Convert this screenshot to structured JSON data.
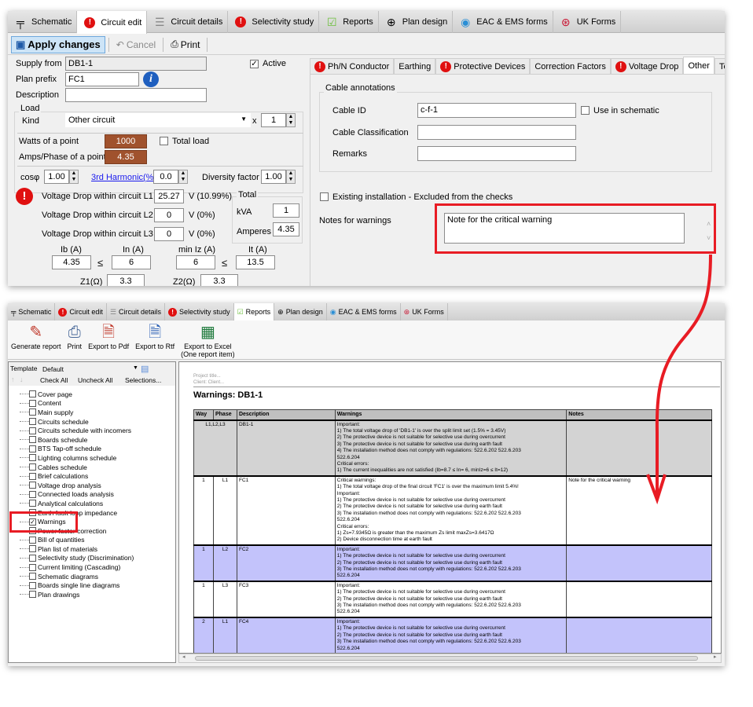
{
  "top_window": {
    "tabs": [
      {
        "label": "Schematic",
        "icon": "schematic-icon"
      },
      {
        "label": "Circuit edit",
        "icon": "circuit-edit-icon",
        "active": true
      },
      {
        "label": "Circuit details",
        "icon": "circuit-details-icon"
      },
      {
        "label": "Selectivity study",
        "icon": "selectivity-icon"
      },
      {
        "label": "Reports",
        "icon": "reports-icon"
      },
      {
        "label": "Plan design",
        "icon": "plan-design-icon"
      },
      {
        "label": "EAC & EMS forms",
        "icon": "eac-icon"
      },
      {
        "label": "UK Forms",
        "icon": "uk-flag-icon"
      }
    ],
    "toolbar": {
      "apply": "Apply changes",
      "cancel": "Cancel",
      "print": "Print"
    },
    "form": {
      "supply_from_label": "Supply from",
      "supply_from": "DB1-1",
      "active_label": "Active",
      "active_checked": true,
      "plan_prefix_label": "Plan prefix",
      "plan_prefix": "FC1",
      "description_label": "Description",
      "description": "",
      "load_label": "Load",
      "kind_label": "Kind",
      "kind": "Other circuit",
      "x_label": "x",
      "multiplier": "1",
      "watts_label": "Watts of a point",
      "watts": "1000",
      "total_load_label": "Total load",
      "total_load_checked": false,
      "amps_label": "Amps/Phase of a point",
      "amps": "4.35",
      "cos_label": "cosφ",
      "cos": "1.00",
      "harmonic_label": "3rd Harmonic(%)",
      "harmonic": "0.0",
      "diversity_label": "Diversity factor",
      "diversity": "1.00",
      "vd_l1_label": "Voltage Drop within circuit L1",
      "vd_l1": "25.27",
      "vd_l1_unit": "V (10.99%)",
      "vd_l2_label": "Voltage Drop within circuit L2",
      "vd_l2": "0",
      "vd_l2_unit": "V (0%)",
      "vd_l3_label": "Voltage Drop within circuit L3",
      "vd_l3": "0",
      "vd_l3_unit": "V (0%)",
      "total_label": "Total",
      "kva_label": "kVA",
      "kva": "1",
      "amperes_label": "Amperes",
      "amperes": "4.35",
      "ib_label": "Ib (A)",
      "ib": "4.35",
      "in_label": "In (A)",
      "in": "6",
      "miniz_label": "min Iz (A)",
      "miniz": "6",
      "it_label": "It (A)",
      "it": "13.5",
      "leq": "≤",
      "z1_label": "Z1(Ω)",
      "z1": "3.3",
      "z2_label": "Z2(Ω)",
      "z2": "3.3"
    },
    "right_tabs": [
      {
        "label": "Ph/N Conductor",
        "warning": true
      },
      {
        "label": "Earthing",
        "warning": false
      },
      {
        "label": "Protective Devices",
        "warning": true
      },
      {
        "label": "Correction Factors",
        "warning": false
      },
      {
        "label": "Voltage Drop",
        "warning": true
      },
      {
        "label": "Other",
        "warning": false,
        "active": true
      },
      {
        "label": "Test",
        "warning": false
      }
    ],
    "other": {
      "cable_annotations": "Cable annotations",
      "cable_id_label": "Cable ID",
      "cable_id": "c-f-1",
      "use_in_schematic": "Use in schematic",
      "cable_class_label": "Cable Classification",
      "cable_class": "",
      "remarks_label": "Remarks",
      "remarks": "",
      "existing_label": "Existing installation - Excluded from the checks",
      "notes_label": "Notes for warnings",
      "notes": "Note for the critical warning"
    }
  },
  "bottom_window": {
    "tabs": [
      {
        "label": "Schematic"
      },
      {
        "label": "Circuit edit"
      },
      {
        "label": "Circuit details"
      },
      {
        "label": "Selectivity study"
      },
      {
        "label": "Reports",
        "active": true
      },
      {
        "label": "Plan design"
      },
      {
        "label": "EAC & EMS forms"
      },
      {
        "label": "UK Forms"
      }
    ],
    "ribbon": {
      "generate": "Generate report",
      "print": "Print",
      "pdf": "Export to Pdf",
      "rtf": "Export to Rtf",
      "excel1": "Export to Excel",
      "excel2": "(One report item)"
    },
    "template_label": "Template",
    "template": "Default",
    "check_all": "Check All",
    "uncheck_all": "Uncheck All",
    "selections": "Selections...",
    "tree": [
      {
        "label": "Cover page",
        "checked": false
      },
      {
        "label": "Content",
        "checked": false
      },
      {
        "label": "Main supply",
        "checked": false
      },
      {
        "label": "Circuits schedule",
        "checked": false
      },
      {
        "label": "Circuits schedule with incomers",
        "checked": false
      },
      {
        "label": "Boards schedule",
        "checked": false
      },
      {
        "label": "BTS Tap-off schedule",
        "checked": false
      },
      {
        "label": "Lighting columns schedule",
        "checked": false
      },
      {
        "label": "Cables schedule",
        "checked": false
      },
      {
        "label": "Brief calculations",
        "checked": false
      },
      {
        "label": "Voltage drop analysis",
        "checked": false
      },
      {
        "label": "Connected loads analysis",
        "checked": false
      },
      {
        "label": "Analytical calculations",
        "checked": false
      },
      {
        "label": "Earth fault loop impedance",
        "checked": false
      },
      {
        "label": "Warnings",
        "checked": true
      },
      {
        "label": "Power factor correction",
        "checked": false
      },
      {
        "label": "Bill of quantities",
        "checked": false
      },
      {
        "label": "Plan list of materials",
        "checked": false
      },
      {
        "label": "Selectivity study (Discrimination)",
        "checked": false
      },
      {
        "label": "Current limiting (Cascading)",
        "checked": false
      },
      {
        "label": "Schematic diagrams",
        "checked": false
      },
      {
        "label": "Boards single line diagrams",
        "checked": false
      },
      {
        "label": "Plan drawings",
        "checked": false
      }
    ],
    "report": {
      "project_title": "Project title...",
      "client": "Client: Client...",
      "title": "Warnings: DB1-1",
      "headers": [
        "Way",
        "Phase",
        "Description",
        "Warnings",
        "Notes"
      ],
      "rows": [
        {
          "way": "",
          "phase": "L1,L2,L3",
          "desc": "DB1-1",
          "style": "gray",
          "notes": "",
          "warnings": [
            "Important:",
            "1) The total voltage drop of 'DB1-1' is over the split limit set (1.5% = 3.45V)",
            "2) The protective device is not suitable for selective use during overcurrent",
            "3) The protective device is not suitable for selective use during earth fault",
            "4) The installation method does not comply with regulations: 522.6.202 522.6.203",
            "522.6.204",
            "Critical errors:",
            "1) The current inequalities are not satisfied (Ib=8.7 ≤ In= 6, minIz=6 ≤ It=12)"
          ]
        },
        {
          "way": "1",
          "phase": "L1",
          "desc": "FC1",
          "style": "white",
          "notes": "Note for the critical warning",
          "warnings": [
            "Critical warnings:",
            "1) The total voltage drop of the final circuit 'FC1' is over the maximum limit 5.4%!",
            "Important:",
            "1) The protective device is not suitable for selective use during overcurrent",
            "2) The protective device is not suitable for selective use during earth fault",
            "3) The installation method does not comply with regulations: 522.6.202 522.6.203",
            "522.6.204",
            "Critical errors:",
            "1) Zs=7.9345Ω  is greater than the maximum Zs limit maxZs=3.6417Ω",
            "2) Device disconnection time at earth fault"
          ]
        },
        {
          "way": "1",
          "phase": "L2",
          "desc": "FC2",
          "style": "blue",
          "notes": "",
          "warnings": [
            "Important:",
            "1) The protective device is not suitable for selective use during overcurrent",
            "2) The protective device is not suitable for selective use during earth fault",
            "3) The installation method does not comply with regulations: 522.6.202 522.6.203",
            "522.6.204"
          ]
        },
        {
          "way": "1",
          "phase": "L3",
          "desc": "FC3",
          "style": "white",
          "notes": "",
          "warnings": [
            "Important:",
            "1) The protective device is not suitable for selective use during overcurrent",
            "2) The protective device is not suitable for selective use during earth fault",
            "3) The installation method does not comply with regulations: 522.6.202 522.6.203",
            "522.6.204"
          ]
        },
        {
          "way": "2",
          "phase": "L1",
          "desc": "FC4",
          "style": "blue",
          "notes": "",
          "warnings": [
            "Important:",
            "1) The protective device is not suitable for selective use during overcurrent",
            "2) The protective device is not suitable for selective use during earth fault",
            "3) The installation method does not comply with regulations: 522.6.202 522.6.203",
            "522.6.204"
          ]
        }
      ]
    }
  },
  "colors": {
    "annotation_red": "#e81c24",
    "brown_field": "#a0522d",
    "row_blue": "#c3c3fb",
    "row_gray": "#d3d3d3"
  }
}
